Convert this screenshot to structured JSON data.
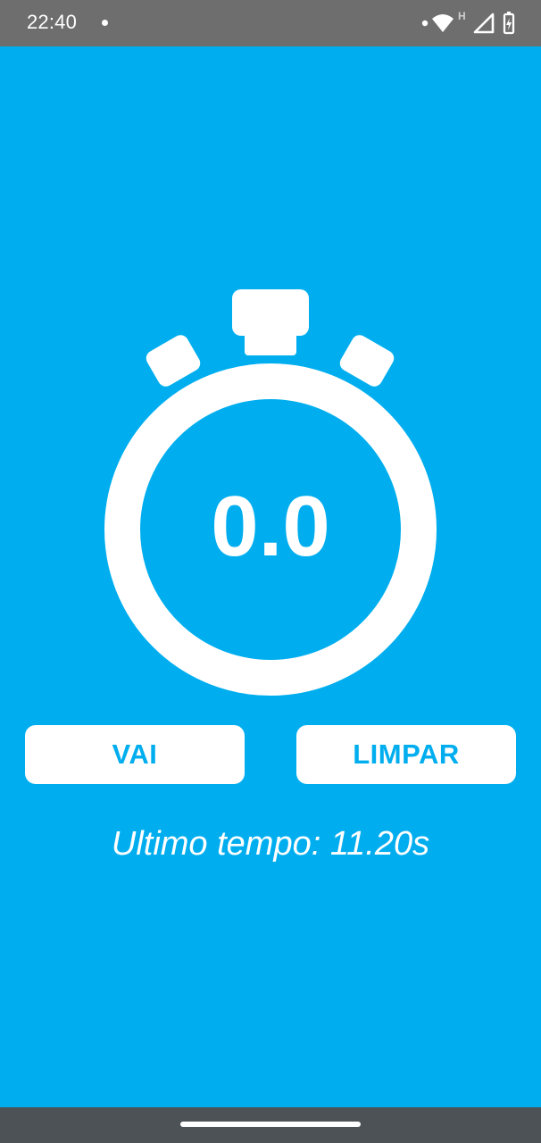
{
  "status_bar": {
    "time": "22:40",
    "network_label": "H",
    "icons": [
      "notification-dot-icon",
      "wifi-icon",
      "signal-icon",
      "battery-charging-icon"
    ]
  },
  "timer": {
    "value": "0.0"
  },
  "buttons": {
    "start_label": "VAI",
    "clear_label": "LIMPAR"
  },
  "last_time": {
    "text": "Ultimo tempo: 11.20s"
  },
  "colors": {
    "background": "#00aeef",
    "status_bar": "#6e6e6e",
    "nav_bar": "#4d5257",
    "foreground": "#ffffff"
  }
}
